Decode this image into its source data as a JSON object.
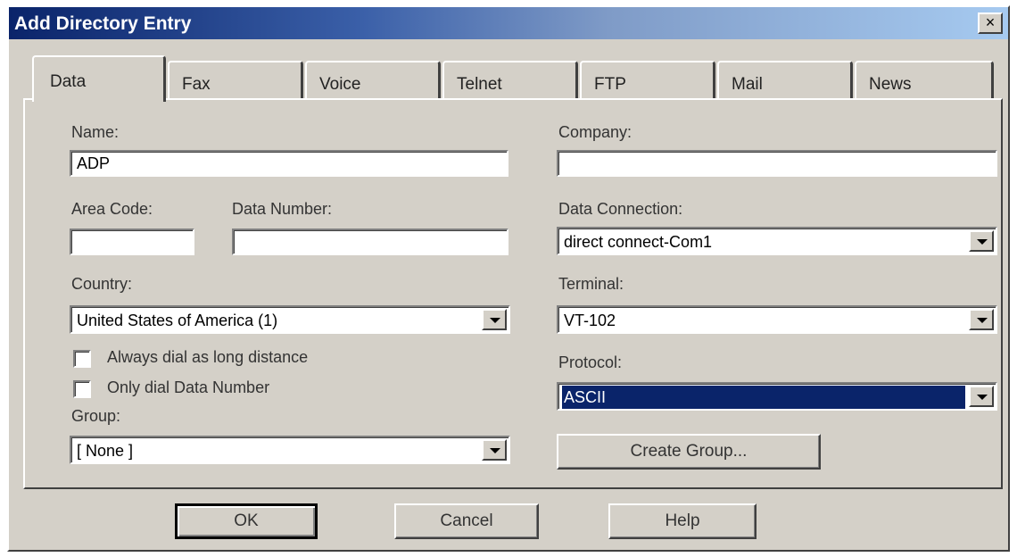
{
  "window": {
    "title": "Add Directory Entry",
    "close_label": "×"
  },
  "tabs": [
    {
      "label": "Data",
      "active": true
    },
    {
      "label": "Fax"
    },
    {
      "label": "Voice"
    },
    {
      "label": "Telnet"
    },
    {
      "label": "FTP"
    },
    {
      "label": "Mail"
    },
    {
      "label": "News"
    }
  ],
  "form": {
    "name_label": "Name:",
    "name_value": "ADP",
    "company_label": "Company:",
    "company_value": "",
    "area_code_label": "Area Code:",
    "area_code_value": "",
    "data_number_label": "Data Number:",
    "data_number_value": "",
    "data_connection_label": "Data Connection:",
    "data_connection_value": "direct connect-Com1",
    "country_label": "Country:",
    "country_value": "United States of America (1)",
    "terminal_label": "Terminal:",
    "terminal_value": "VT-102",
    "always_dial_label": "Always dial as long distance",
    "always_dial_checked": false,
    "only_dial_label": "Only dial Data Number",
    "only_dial_checked": false,
    "protocol_label": "Protocol:",
    "protocol_value": "ASCII",
    "group_label": "Group:",
    "group_value": "[ None ]",
    "create_group_label": "Create Group..."
  },
  "buttons": {
    "ok": "OK",
    "cancel": "Cancel",
    "help": "Help"
  },
  "colors": {
    "titlebar_start": "#0a246a",
    "selection": "#0a246a",
    "face": "#d4d0c8"
  }
}
